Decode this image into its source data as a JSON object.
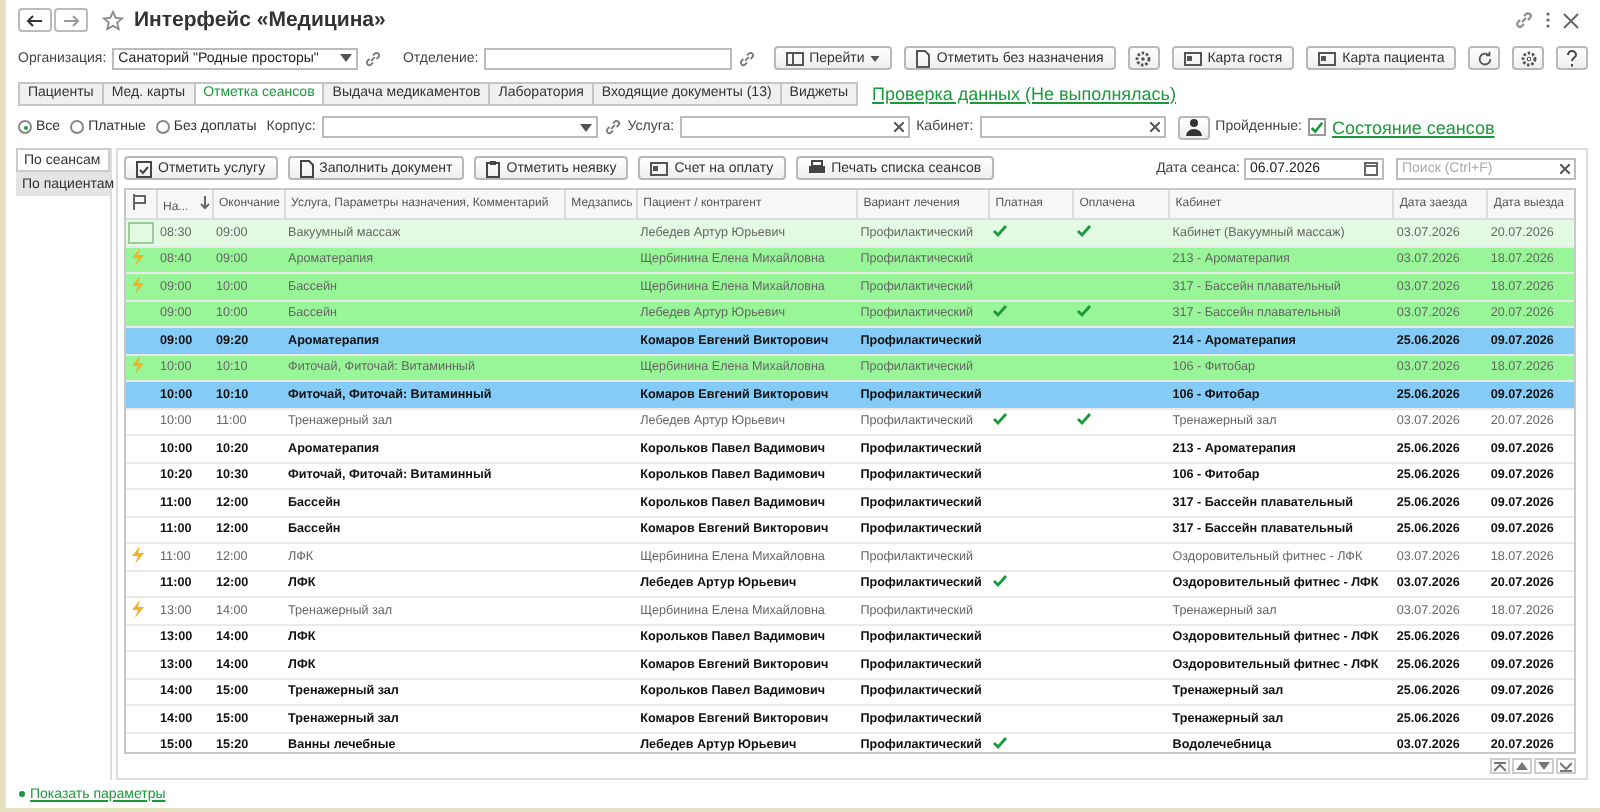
{
  "window": {
    "title": "Интерфейс «Медицина»"
  },
  "organization": {
    "label": "Организация:",
    "value": "Санаторий \"Родные просторы\""
  },
  "department": {
    "label": "Отделение:"
  },
  "actions": [
    {
      "label": "Перейти",
      "kind": "menu"
    },
    {
      "label": "Отметить без назначения",
      "kind": "doc"
    },
    {
      "label": "Карта гостя",
      "kind": "card"
    },
    {
      "label": "Карта пациента",
      "kind": "card"
    }
  ],
  "tabs": [
    {
      "label": "Пациенты",
      "selected": false
    },
    {
      "label": "Мед. карты",
      "selected": false
    },
    {
      "label": "Отметка сеансов",
      "selected": true
    },
    {
      "label": "Выдача медикаментов",
      "selected": false
    },
    {
      "label": "Лаборатория",
      "selected": false
    },
    {
      "label": "Входящие документы (13)",
      "selected": false
    },
    {
      "label": "Виджеты",
      "selected": false
    }
  ],
  "check_link": "Проверка данных (Не выполнялась)",
  "payment_filter": [
    {
      "label": "Все",
      "selected": true
    },
    {
      "label": "Платные",
      "selected": false
    },
    {
      "label": "Без доплаты",
      "selected": false
    }
  ],
  "building": {
    "label": "Корпус:"
  },
  "service": {
    "label": "Услуга:"
  },
  "cabinet": {
    "label": "Кабинет:"
  },
  "passed": {
    "label": "Пройденные:",
    "checked": true
  },
  "sessions_link": "Состояние сеансов",
  "views": [
    {
      "label": "По сеансам",
      "selected": true
    },
    {
      "label": "По пациентам",
      "selected": false
    }
  ],
  "toolbar": [
    {
      "label": "Отметить услугу",
      "kind": "mark"
    },
    {
      "label": "Заполнить документ",
      "kind": "doc"
    },
    {
      "label": "Отметить неявку",
      "kind": "clip"
    },
    {
      "label": "Счет на оплату",
      "kind": "card"
    },
    {
      "label": "Печать списка сеансов",
      "kind": "print"
    }
  ],
  "session_date": {
    "label": "Дата сеанса:",
    "value": "06.07.2026"
  },
  "search": {
    "placeholder": "Поиск (Ctrl+F)"
  },
  "table": {
    "columns": [
      "На...",
      "Окончание",
      "Услуга, Параметры назначения, Комментарий",
      "Медзапись",
      "Пациент / контрагент",
      "Вариант лечения",
      "Платная",
      "Оплачена",
      "Кабинет",
      "Дата заезда",
      "Дата выезда"
    ],
    "rows": [
      {
        "kind": "selected",
        "bold": false,
        "flag": false,
        "start": "08:30",
        "end": "09:00",
        "service": "Вакуумный массаж",
        "patient": "Лебедев Артур Юрьевич",
        "variant": "Профилактический",
        "paid": true,
        "payed": true,
        "cabinet": "Кабинет (Вакуумный массаж)",
        "arrival": "03.07.2026",
        "departure": "20.07.2026"
      },
      {
        "kind": "green",
        "bold": false,
        "flag": true,
        "start": "08:40",
        "end": "09:00",
        "service": "Ароматерапия",
        "patient": "Щербинина Елена Михайловна",
        "variant": "Профилактический",
        "paid": false,
        "payed": false,
        "cabinet": "213 - Ароматерапия",
        "arrival": "03.07.2026",
        "departure": "18.07.2026"
      },
      {
        "kind": "green",
        "bold": false,
        "flag": true,
        "start": "09:00",
        "end": "10:00",
        "service": "Бассейн",
        "patient": "Щербинина Елена Михайловна",
        "variant": "Профилактический",
        "paid": false,
        "payed": false,
        "cabinet": "317 - Бассейн плавательный",
        "arrival": "03.07.2026",
        "departure": "18.07.2026"
      },
      {
        "kind": "green",
        "bold": false,
        "flag": false,
        "start": "09:00",
        "end": "10:00",
        "service": "Бассейн",
        "patient": "Лебедев Артур Юрьевич",
        "variant": "Профилактический",
        "paid": true,
        "payed": true,
        "cabinet": "317 - Бассейн плавательный",
        "arrival": "03.07.2026",
        "departure": "20.07.2026"
      },
      {
        "kind": "blue",
        "bold": true,
        "flag": false,
        "start": "09:00",
        "end": "09:20",
        "service": "Ароматерапия",
        "patient": "Комаров Евгений Викторович",
        "variant": "Профилактический",
        "paid": false,
        "payed": false,
        "cabinet": "214 - Ароматерапия",
        "arrival": "25.06.2026",
        "departure": "09.07.2026"
      },
      {
        "kind": "green",
        "bold": false,
        "flag": true,
        "start": "10:00",
        "end": "10:10",
        "service": "Фиточай, Фиточай: Витаминный",
        "patient": "Щербинина Елена Михайловна",
        "variant": "Профилактический",
        "paid": false,
        "payed": false,
        "cabinet": "106 - Фитобар",
        "arrival": "03.07.2026",
        "departure": "18.07.2026"
      },
      {
        "kind": "blue",
        "bold": true,
        "flag": false,
        "start": "10:00",
        "end": "10:10",
        "service": "Фиточай, Фиточай: Витаминный",
        "patient": "Комаров Евгений Викторович",
        "variant": "Профилактический",
        "paid": false,
        "payed": false,
        "cabinet": "106 - Фитобар",
        "arrival": "25.06.2026",
        "departure": "09.07.2026"
      },
      {
        "kind": "plain",
        "bold": false,
        "flag": false,
        "start": "10:00",
        "end": "11:00",
        "service": "Тренажерный зал",
        "patient": "Лебедев Артур Юрьевич",
        "variant": "Профилактический",
        "paid": true,
        "payed": true,
        "cabinet": "Тренажерный зал",
        "arrival": "03.07.2026",
        "departure": "20.07.2026"
      },
      {
        "kind": "plain",
        "bold": true,
        "flag": false,
        "start": "10:00",
        "end": "10:20",
        "service": "Ароматерапия",
        "patient": "Корольков Павел Вадимович",
        "variant": "Профилактический",
        "paid": false,
        "payed": false,
        "cabinet": "213 - Ароматерапия",
        "arrival": "25.06.2026",
        "departure": "09.07.2026"
      },
      {
        "kind": "plain",
        "bold": true,
        "flag": false,
        "start": "10:20",
        "end": "10:30",
        "service": "Фиточай, Фиточай: Витаминный",
        "patient": "Корольков Павел Вадимович",
        "variant": "Профилактический",
        "paid": false,
        "payed": false,
        "cabinet": "106 - Фитобар",
        "arrival": "25.06.2026",
        "departure": "09.07.2026"
      },
      {
        "kind": "plain",
        "bold": true,
        "flag": false,
        "start": "11:00",
        "end": "12:00",
        "service": "Бассейн",
        "patient": "Корольков Павел Вадимович",
        "variant": "Профилактический",
        "paid": false,
        "payed": false,
        "cabinet": "317 - Бассейн плавательный",
        "arrival": "25.06.2026",
        "departure": "09.07.2026"
      },
      {
        "kind": "plain",
        "bold": true,
        "flag": false,
        "start": "11:00",
        "end": "12:00",
        "service": "Бассейн",
        "patient": "Комаров Евгений Викторович",
        "variant": "Профилактический",
        "paid": false,
        "payed": false,
        "cabinet": "317 - Бассейн плавательный",
        "arrival": "25.06.2026",
        "departure": "09.07.2026"
      },
      {
        "kind": "plain",
        "bold": false,
        "flag": true,
        "start": "11:00",
        "end": "12:00",
        "service": "ЛФК",
        "patient": "Щербинина Елена Михайловна",
        "variant": "Профилактический",
        "paid": false,
        "payed": false,
        "cabinet": "Оздоровительный фитнес - ЛФК",
        "arrival": "03.07.2026",
        "departure": "18.07.2026"
      },
      {
        "kind": "plain",
        "bold": true,
        "flag": false,
        "start": "11:00",
        "end": "12:00",
        "service": "ЛФК",
        "patient": "Лебедев Артур Юрьевич",
        "variant": "Профилактический",
        "paid": true,
        "payed": false,
        "cabinet": "Оздоровительный фитнес - ЛФК",
        "arrival": "03.07.2026",
        "departure": "20.07.2026"
      },
      {
        "kind": "plain",
        "bold": false,
        "flag": true,
        "start": "13:00",
        "end": "14:00",
        "service": "Тренажерный зал",
        "patient": "Щербинина Елена Михайловна",
        "variant": "Профилактический",
        "paid": false,
        "payed": false,
        "cabinet": "Тренажерный зал",
        "arrival": "03.07.2026",
        "departure": "18.07.2026"
      },
      {
        "kind": "plain",
        "bold": true,
        "flag": false,
        "start": "13:00",
        "end": "14:00",
        "service": "ЛФК",
        "patient": "Корольков Павел Вадимович",
        "variant": "Профилактический",
        "paid": false,
        "payed": false,
        "cabinet": "Оздоровительный фитнес - ЛФК",
        "arrival": "25.06.2026",
        "departure": "09.07.2026"
      },
      {
        "kind": "plain",
        "bold": true,
        "flag": false,
        "start": "13:00",
        "end": "14:00",
        "service": "ЛФК",
        "patient": "Комаров Евгений Викторович",
        "variant": "Профилактический",
        "paid": false,
        "payed": false,
        "cabinet": "Оздоровительный фитнес - ЛФК",
        "arrival": "25.06.2026",
        "departure": "09.07.2026"
      },
      {
        "kind": "plain",
        "bold": true,
        "flag": false,
        "start": "14:00",
        "end": "15:00",
        "service": "Тренажерный зал",
        "patient": "Корольков Павел Вадимович",
        "variant": "Профилактический",
        "paid": false,
        "payed": false,
        "cabinet": "Тренажерный зал",
        "arrival": "25.06.2026",
        "departure": "09.07.2026"
      },
      {
        "kind": "plain",
        "bold": true,
        "flag": false,
        "start": "14:00",
        "end": "15:00",
        "service": "Тренажерный зал",
        "patient": "Комаров Евгений Викторович",
        "variant": "Профилактический",
        "paid": false,
        "payed": false,
        "cabinet": "Тренажерный зал",
        "arrival": "25.06.2026",
        "departure": "09.07.2026"
      },
      {
        "kind": "plain",
        "bold": true,
        "flag": false,
        "start": "15:00",
        "end": "15:20",
        "service": "Ванны лечебные",
        "patient": "Лебедев Артур Юрьевич",
        "variant": "Профилактический",
        "paid": true,
        "payed": false,
        "cabinet": "Водолечебница",
        "arrival": "03.07.2026",
        "departure": "20.07.2026"
      }
    ]
  },
  "footer_link": "Показать параметры"
}
